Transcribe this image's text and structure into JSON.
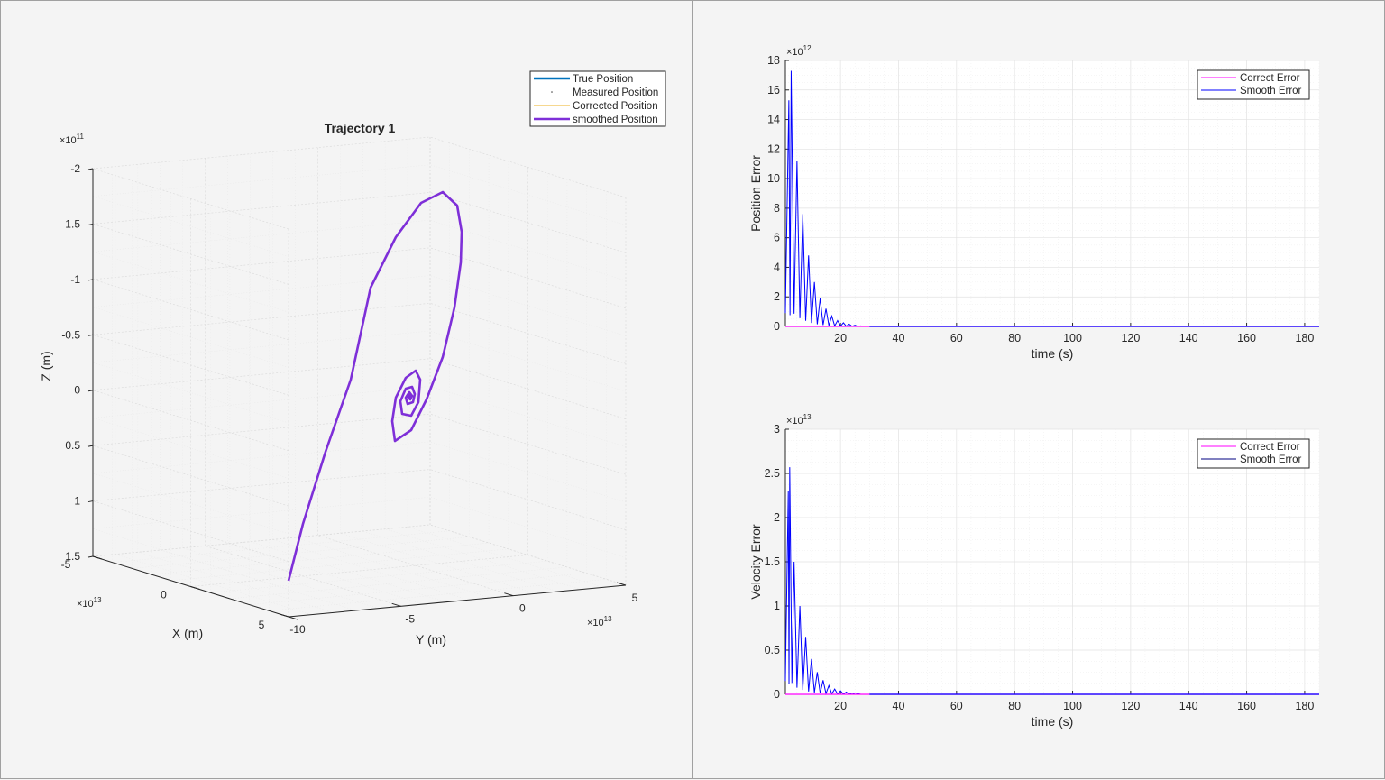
{
  "colors": {
    "true_position": "#0072BD",
    "corrected_position": "#EDB120",
    "smoothed_position": "#7E2FD8",
    "correct_error": "#FF00FF",
    "smooth_error": "#0000FF"
  },
  "chart_data": [
    {
      "type": "line3d",
      "title": "Trajectory 1",
      "xlabel": "X (m)",
      "ylabel": "Y (m)",
      "zlabel": "Z (m)",
      "x_exponent": "13",
      "y_exponent": "13",
      "z_exponent": "11",
      "exponent_base": "×10",
      "xlim": [
        -5,
        5
      ],
      "ylim": [
        -10,
        5
      ],
      "zlim": [
        -2,
        1.5
      ],
      "z_reversed": true,
      "x_ticks": [
        "-5",
        "0",
        "5"
      ],
      "y_ticks": [
        "-10",
        "-5",
        "0",
        "5"
      ],
      "z_ticks": [
        "-2",
        "-1.5",
        "-1",
        "-0.5",
        "0",
        "0.5",
        "1",
        "1.5"
      ],
      "grid": true,
      "legend_position": "top-right",
      "legend": [
        "True Position",
        "Measured Position",
        "Corrected Position",
        "smoothed Position"
      ],
      "series": [
        {
          "name": "smoothed Position",
          "style": "spiral converging to origin",
          "start": [
            5,
            -10,
            1.5
          ],
          "end": [
            0,
            0,
            0
          ]
        }
      ]
    },
    {
      "type": "line",
      "ylabel": "Position Error",
      "xlabel": "time (s)",
      "y_exponent": "12",
      "exponent_base": "×10",
      "xlim": [
        1,
        185
      ],
      "ylim": [
        0,
        18
      ],
      "x_ticks": [
        "20",
        "40",
        "60",
        "80",
        "100",
        "120",
        "140",
        "160",
        "180"
      ],
      "y_ticks": [
        "0",
        "2",
        "4",
        "6",
        "8",
        "10",
        "12",
        "14",
        "16",
        "18"
      ],
      "grid": true,
      "legend_position": "top-right",
      "legend": [
        "Correct Error",
        "Smooth Error"
      ],
      "series": [
        {
          "name": "Correct Error",
          "values": "≈0 for all t"
        },
        {
          "name": "Smooth Error",
          "style": "decaying oscillation",
          "peaks": [
            [
              2.2,
              15.3
            ],
            [
              3,
              17.3
            ],
            [
              5,
              11.2
            ],
            [
              7,
              7.6
            ],
            [
              9,
              4.8
            ],
            [
              11,
              3.0
            ],
            [
              13,
              1.9
            ],
            [
              15,
              1.2
            ],
            [
              17,
              0.7
            ],
            [
              19,
              0.4
            ],
            [
              21,
              0.25
            ],
            [
              23,
              0.15
            ],
            [
              25,
              0.08
            ],
            [
              27,
              0.04
            ]
          ]
        }
      ]
    },
    {
      "type": "line",
      "ylabel": "Velocity Error",
      "xlabel": "time (s)",
      "y_exponent": "13",
      "exponent_base": "×10",
      "xlim": [
        1,
        185
      ],
      "ylim": [
        0,
        3
      ],
      "x_ticks": [
        "20",
        "40",
        "60",
        "80",
        "100",
        "120",
        "140",
        "160",
        "180"
      ],
      "y_ticks": [
        "0",
        "0.5",
        "1",
        "1.5",
        "2",
        "2.5",
        "3"
      ],
      "grid": true,
      "legend_position": "top-right",
      "legend": [
        "Correct Error",
        "Smooth Error"
      ],
      "series": [
        {
          "name": "Correct Error",
          "values": "≈0 for all t"
        },
        {
          "name": "Smooth Error",
          "style": "decaying oscillation",
          "peaks": [
            [
              2,
              2.3
            ],
            [
              2.5,
              2.57
            ],
            [
              4,
              1.5
            ],
            [
              6,
              1.0
            ],
            [
              8,
              0.65
            ],
            [
              10,
              0.4
            ],
            [
              12,
              0.25
            ],
            [
              14,
              0.16
            ],
            [
              16,
              0.1
            ],
            [
              18,
              0.06
            ],
            [
              20,
              0.04
            ],
            [
              22,
              0.025
            ],
            [
              24,
              0.015
            ],
            [
              26,
              0.008
            ]
          ]
        }
      ]
    }
  ]
}
